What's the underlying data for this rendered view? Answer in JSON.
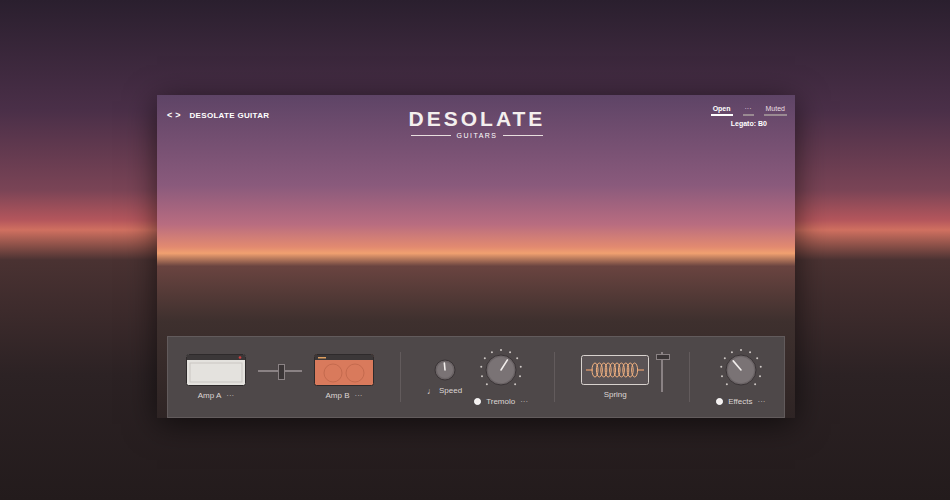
{
  "header": {
    "nav_prev": "<",
    "nav_next": ">",
    "preset": "DESOLATE GUITAR"
  },
  "logo": {
    "title": "DESOLATE",
    "subtitle": "GUITARS"
  },
  "articulation": {
    "options": [
      {
        "label": "Open",
        "selected": true
      },
      {
        "label": "···",
        "selected": false
      },
      {
        "label": "Muted",
        "selected": false
      }
    ],
    "legato": "Legato: B0"
  },
  "amps": [
    {
      "label": "Amp A",
      "menu": "···",
      "color": "#e4e2de"
    },
    {
      "label": "Amp B",
      "menu": "···",
      "color": "#d97a5c"
    }
  ],
  "amp_blend": {
    "level": 0.5
  },
  "speed": {
    "label": "Speed",
    "sync_icon": "♩",
    "level": 0.48
  },
  "tremolo": {
    "label": "Tremolo",
    "menu": "···",
    "on": true,
    "level": 0.62
  },
  "reverb": {
    "label": "Spring",
    "level": 0.85
  },
  "effects": {
    "label": "Effects",
    "menu": "···",
    "on": true,
    "level": 0.35
  }
}
